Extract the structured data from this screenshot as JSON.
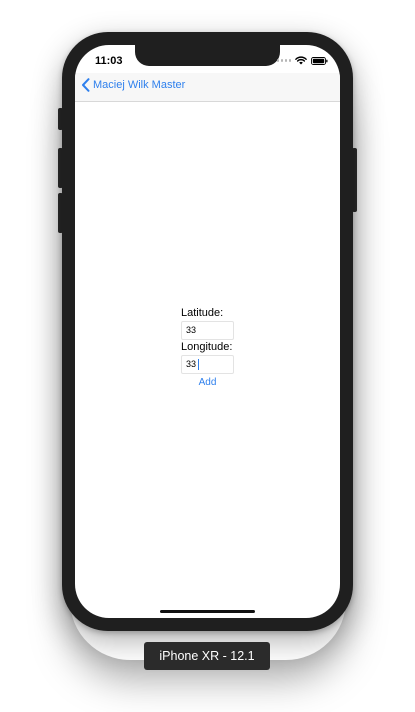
{
  "status_bar": {
    "time": "11:03"
  },
  "nav": {
    "back_label": "Maciej Wilk Master"
  },
  "form": {
    "latitude_label": "Latitude:",
    "latitude_value": "33",
    "longitude_label": "Longitude:",
    "longitude_value": "33",
    "add_label": "Add"
  },
  "device": {
    "label": "iPhone XR - 12.1"
  },
  "colors": {
    "accent": "#2f80ed",
    "device_frame": "#1f1f1f",
    "nav_background": "#f7f7f7"
  },
  "icons": {
    "back": "chevron-left-icon",
    "wifi": "wifi-icon",
    "battery": "battery-icon",
    "signal": "signal-dots-icon"
  }
}
